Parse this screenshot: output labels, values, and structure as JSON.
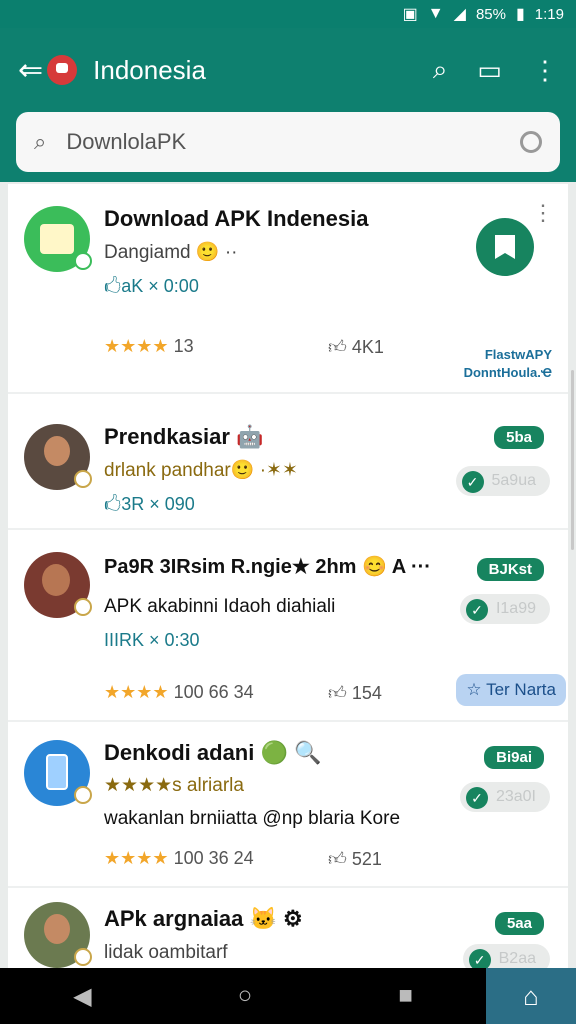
{
  "status": {
    "time": "1:19",
    "battery": "85%"
  },
  "appbar": {
    "title": "Indonesia",
    "back_icon": "back-arrow-icon",
    "search_icon": "search-icon",
    "cast_icon": "cast-icon",
    "menu_icon": "more-vert-icon"
  },
  "search": {
    "value": "DownlolaPK"
  },
  "items": [
    {
      "title": "Download APK Indenesia",
      "subtitle": "Dangiamd 🙂 ··",
      "meta": "🖒aK × 0:00",
      "stars": "★★★★",
      "rating_count": "13",
      "likes": "4K1",
      "side_label_1": "FlastwAPY",
      "side_label_2": "DonntHoula.Ҽ"
    },
    {
      "title": "Prendkasiar 🤖",
      "subtitle": "drlank pandhar🙂 ·✶✶",
      "meta": "🖒3R × 090",
      "pill_green": "5ba",
      "pill_grey": "5a9ua"
    },
    {
      "title": "Pa9R 3IRsim R.ngie★ 2hm 😊 A ···",
      "subtitle": "APK akabinni Idaoh diahiali",
      "meta": "IIIRK × 0:30",
      "stars": "★★★★",
      "rating_count": "100 66 34",
      "likes": "154",
      "pill_green": "BJKst",
      "pill_grey": "I1a99",
      "chip": "Ter Narta"
    },
    {
      "title": "Denkodi adani 🟢 🔍",
      "subtitle": "★★★★s alriarla",
      "meta": "wakanlan brniiatta @np blaria Kore",
      "stars": "★★★★",
      "rating_count": "100 36 24",
      "likes": "521",
      "pill_green": "Bi9ai",
      "pill_grey": "23a0I"
    },
    {
      "title": "APk argnaiaa 🐱 ⚙",
      "subtitle": "lidak oambitarf",
      "pill_green": "5aa",
      "pill_grey": "B2aa"
    }
  ],
  "colors": {
    "primary": "#0e806f",
    "accent_green": "#17845f",
    "star": "#f2a62a"
  }
}
